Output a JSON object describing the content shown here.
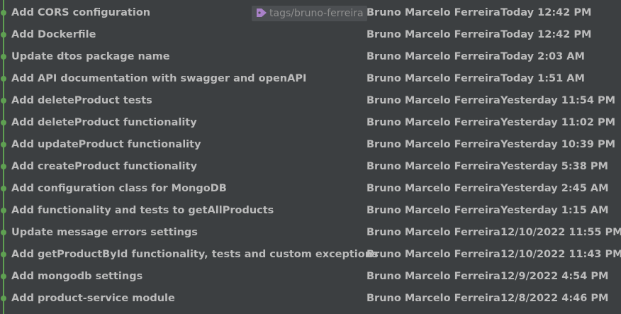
{
  "accent_color": "#5fa052",
  "tag": {
    "label": "tags/bruno-ferreira",
    "icon": "tag-icon"
  },
  "commits": [
    {
      "message": "Add CORS configuration",
      "author": "Bruno Marcelo Ferreira",
      "date": "Today 12:42 PM"
    },
    {
      "message": "Add Dockerfile",
      "author": "Bruno Marcelo Ferreira",
      "date": "Today 12:42 PM"
    },
    {
      "message": "Update dtos package name",
      "author": "Bruno Marcelo Ferreira",
      "date": "Today 2:03 AM"
    },
    {
      "message": "Add API documentation with swagger and openAPI",
      "author": "Bruno Marcelo Ferreira",
      "date": "Today 1:51 AM"
    },
    {
      "message": "Add deleteProduct tests",
      "author": "Bruno Marcelo Ferreira",
      "date": "Yesterday 11:54 PM"
    },
    {
      "message": "Add deleteProduct functionality",
      "author": "Bruno Marcelo Ferreira",
      "date": "Yesterday 11:02 PM"
    },
    {
      "message": "Add updateProduct functionality",
      "author": "Bruno Marcelo Ferreira",
      "date": "Yesterday 10:39 PM"
    },
    {
      "message": "Add createProduct functionality",
      "author": "Bruno Marcelo Ferreira",
      "date": "Yesterday 5:38 PM"
    },
    {
      "message": "Add configuration class for MongoDB",
      "author": "Bruno Marcelo Ferreira",
      "date": "Yesterday 2:45 AM"
    },
    {
      "message": "Add functionality and tests to getAllProducts",
      "author": "Bruno Marcelo Ferreira",
      "date": "Yesterday 1:15 AM"
    },
    {
      "message": "Update message errors settings",
      "author": "Bruno Marcelo Ferreira",
      "date": "12/10/2022 11:55 PM"
    },
    {
      "message": "Add getProductById functionality, tests and custom exceptions",
      "author": "Bruno Marcelo Ferreira",
      "date": "12/10/2022 11:43 PM"
    },
    {
      "message": "Add mongodb settings",
      "author": "Bruno Marcelo Ferreira",
      "date": "12/9/2022 4:54 PM"
    },
    {
      "message": "Add product-service module",
      "author": "Bruno Marcelo Ferreira",
      "date": "12/8/2022 4:46 PM"
    }
  ]
}
